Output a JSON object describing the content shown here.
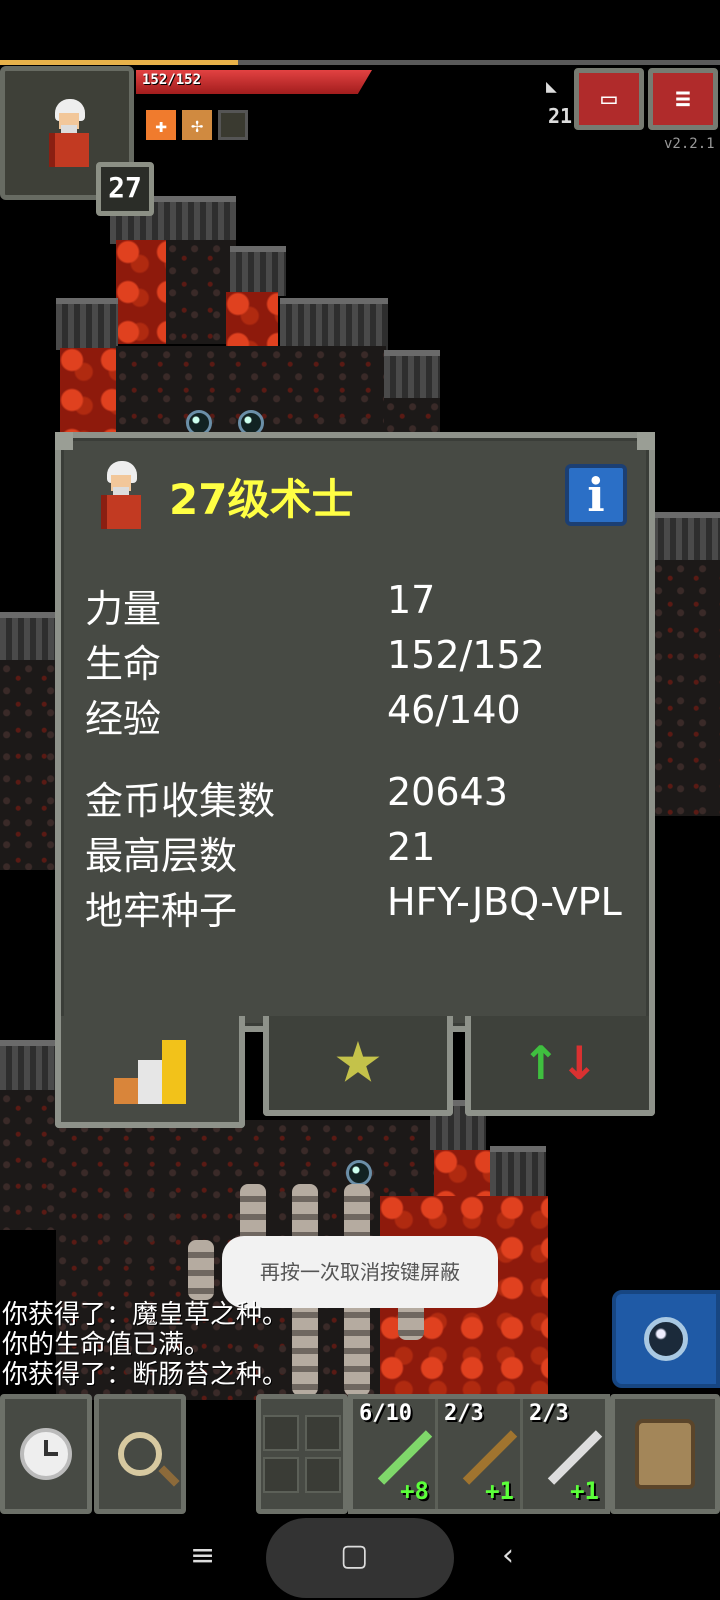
{
  "hud": {
    "hp_text": "152/152",
    "hp_fraction": 1.0,
    "xp_fraction": 0.33,
    "level": "27",
    "depth": "21",
    "version": "v2.2.1",
    "buffs": [
      "bless-icon",
      "herb-buff-icon",
      "shield-buff-icon"
    ]
  },
  "hero_window": {
    "title": "27级术士",
    "stats": [
      {
        "label": "力量",
        "value": "17"
      },
      {
        "label": "生命",
        "value": "152/152"
      },
      {
        "label": "经验",
        "value": "46/140"
      },
      {
        "label": "金币收集数",
        "value": "20643"
      },
      {
        "label": "最高层数",
        "value": "21"
      },
      {
        "label": "地牢种子",
        "value": "HFY-JBQ-VPL"
      }
    ],
    "tabs": [
      "stats-icon",
      "star-icon",
      "swap-icon"
    ]
  },
  "toast": "再按一次取消按键屏蔽",
  "log": [
    "你获得了：魔皇草之种。",
    "你的生命值已满。",
    "你获得了：断肠苔之种。"
  ],
  "quickslots": [
    {
      "charge": "6/10",
      "upgrade": "+8",
      "color": "#7fd86a"
    },
    {
      "charge": "2/3",
      "upgrade": "+1",
      "color": "#a0742f"
    },
    {
      "charge": "2/3",
      "upgrade": "+1",
      "color": "#dddddd"
    }
  ],
  "colors": {
    "title": "#ffff44",
    "panel": "#474a44",
    "hp": "#d93131",
    "accent_blue": "#2b6fc6"
  }
}
